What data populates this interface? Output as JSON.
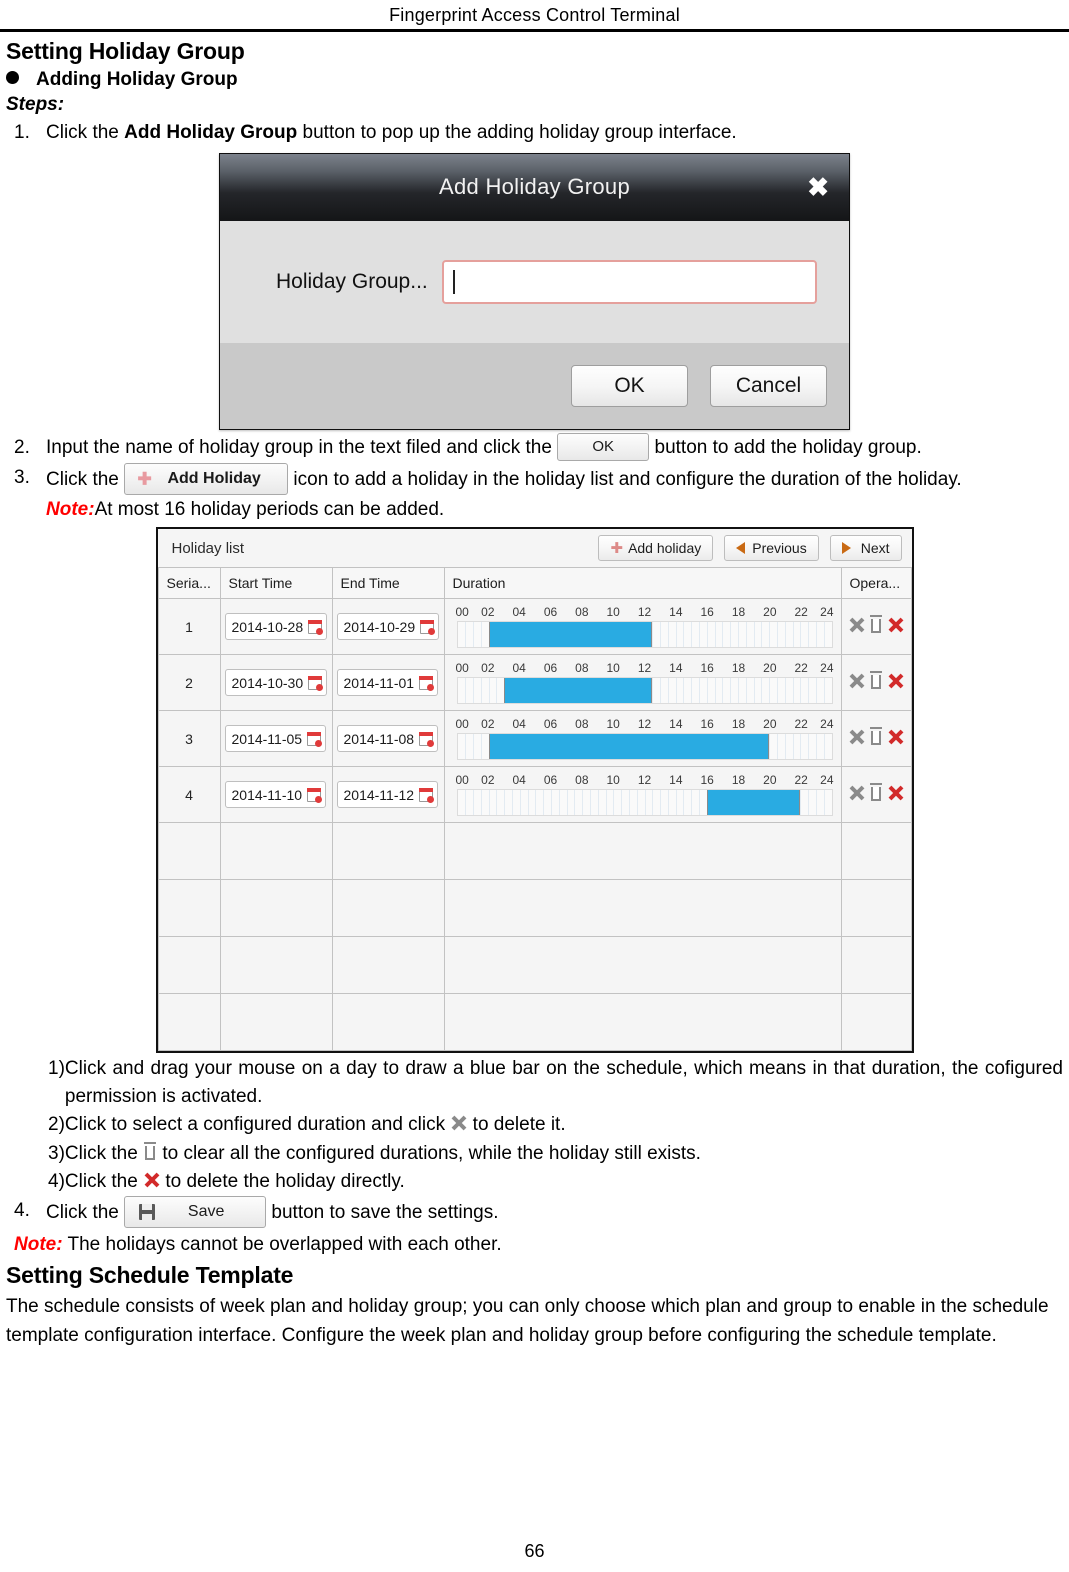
{
  "header": {
    "running_head": "Fingerprint Access Control Terminal"
  },
  "section": {
    "title": "Setting Holiday Group",
    "bullet": "Adding Holiday Group",
    "steps_label": "Steps:"
  },
  "steps": {
    "s1_num": "1.",
    "s1_pre": "Click the ",
    "s1_bold": "Add Holiday Group",
    "s1_post": " button to pop up the adding holiday group interface.",
    "s2_num": "2.",
    "s2_pre": "Input the name of holiday group in the text filed and click the ",
    "s2_post": " button to add the holiday group.",
    "s3_num": "3.",
    "s3_pre": "Click the ",
    "s3_post": " icon to add a holiday in the holiday list and configure the duration of the holiday.",
    "s3_note_label": "Note:",
    "s3_note_text": "At most 16 holiday periods can be added.",
    "s4_num": "4.",
    "s4_pre": "Click the ",
    "s4_post": " button to save the settings."
  },
  "substeps": [
    {
      "num": "1)",
      "pre": "Click and drag your mouse on a day to draw a blue bar on the schedule, which means in that duration, the cofigured permission is activated.",
      "post": ""
    },
    {
      "num": "2)",
      "pre": "Click to select a configured duration and click ",
      "post": " to delete it."
    },
    {
      "num": "3)",
      "pre": "Click the ",
      "post": " to clear all the configured durations, while the holiday still exists."
    },
    {
      "num": "4)",
      "pre": "Click the ",
      "post": " to delete the holiday directly."
    }
  ],
  "final_note": {
    "label": "Note:",
    "text": " The holidays cannot be overlapped with each other."
  },
  "schedule_section": {
    "title": "Setting Schedule Template",
    "paragraph": "The schedule consists of week plan and holiday group; you can only choose which plan and group to enable in the schedule template configuration interface. Configure the week plan and holiday group before configuring the schedule template."
  },
  "dialog": {
    "title": "Add Holiday Group",
    "close_icon": "✖",
    "field_label": "Holiday Group...",
    "field_value": "",
    "ok_label": "OK",
    "cancel_label": "Cancel"
  },
  "inline_chips": {
    "ok_label": "OK",
    "add_holiday_label": "Add Holiday",
    "save_label": "Save",
    "plus_glyph": "✚"
  },
  "holiday_panel": {
    "panel_title": "Holiday list",
    "add_holiday_label": "Add holiday",
    "previous_label": "Previous",
    "next_label": "Next",
    "columns": [
      "Seria...",
      "Start Time",
      "End Time",
      "Duration",
      "Opera..."
    ],
    "tick_labels": [
      "00",
      "02",
      "04",
      "06",
      "08",
      "10",
      "12",
      "14",
      "16",
      "18",
      "20",
      "22",
      "24"
    ],
    "rows": [
      {
        "serial": "1",
        "start": "2014-10-28",
        "end": "2014-10-29",
        "bar_start_hour": 2,
        "bar_end_hour": 12.5
      },
      {
        "serial": "2",
        "start": "2014-10-30",
        "end": "2014-11-01",
        "bar_start_hour": 3,
        "bar_end_hour": 12.5
      },
      {
        "serial": "3",
        "start": "2014-11-05",
        "end": "2014-11-08",
        "bar_start_hour": 2,
        "bar_end_hour": 20
      },
      {
        "serial": "4",
        "start": "2014-11-10",
        "end": "2014-11-12",
        "bar_start_hour": 16,
        "bar_end_hour": 22
      }
    ],
    "empty_rows": 4,
    "accent_bar_color": "#29abe2",
    "operation_icons": [
      "clear-duration-icon",
      "clear-all-durations-icon",
      "delete-holiday-icon"
    ]
  },
  "footer": {
    "page_number": "66"
  }
}
